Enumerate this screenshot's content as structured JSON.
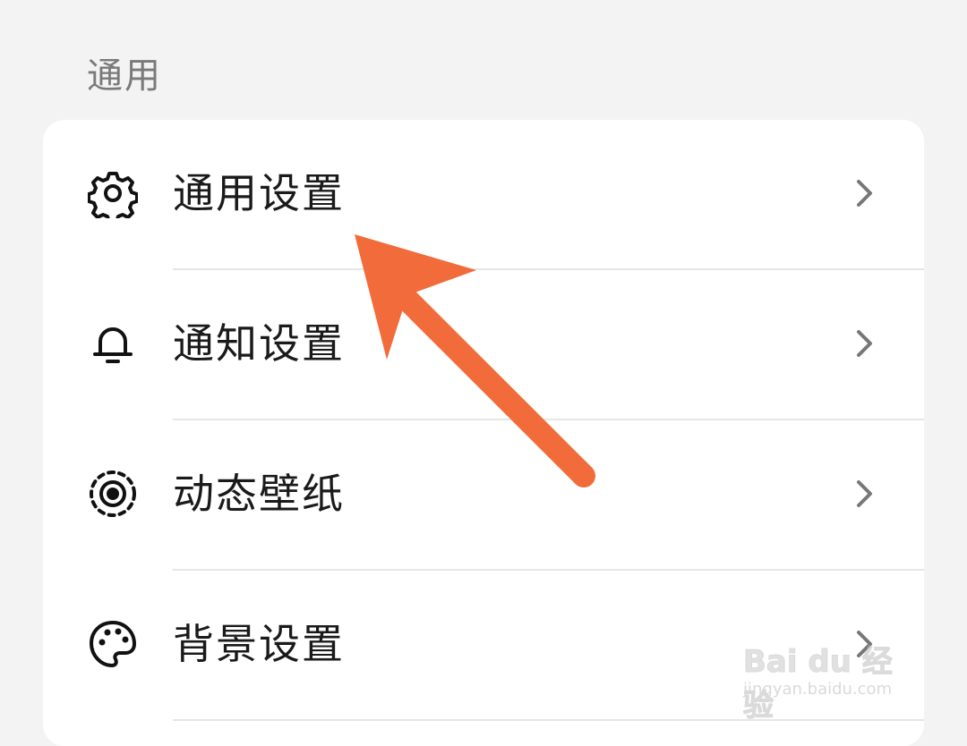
{
  "section": {
    "title": "通用"
  },
  "menu": {
    "items": [
      {
        "label": "通用设置",
        "icon": "gear-icon"
      },
      {
        "label": "通知设置",
        "icon": "bell-icon"
      },
      {
        "label": "动态壁纸",
        "icon": "dynamic-wallpaper-icon"
      },
      {
        "label": "背景设置",
        "icon": "palette-icon"
      }
    ]
  },
  "annotation": {
    "arrow_color": "#f26b3a"
  },
  "watermark": {
    "brand": "Bai du 经验",
    "url": "jingyan.baidu.com"
  }
}
